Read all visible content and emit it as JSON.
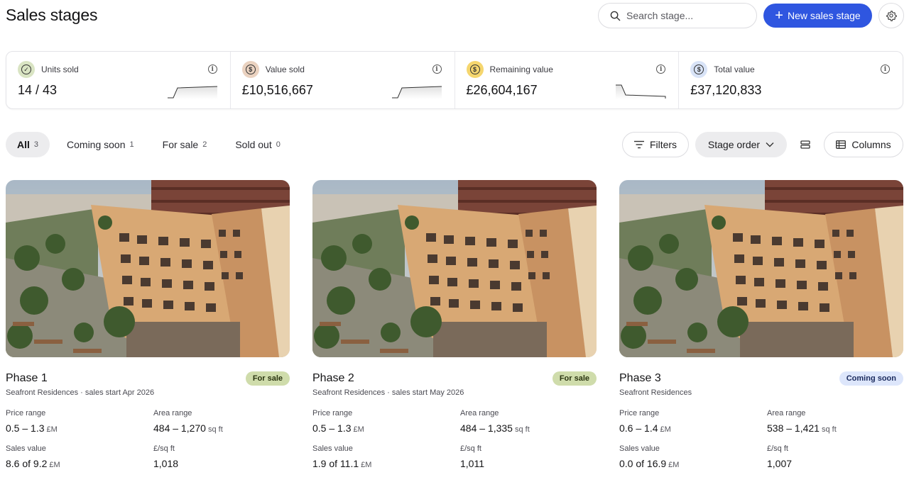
{
  "header": {
    "title": "Sales stages",
    "search_placeholder": "Search stage...",
    "new_button": "New sales stage"
  },
  "stats": [
    {
      "label": "Units sold",
      "value": "14 / 43",
      "icon": "check-circle-icon",
      "icon_bg": "#d9e4c3"
    },
    {
      "label": "Value sold",
      "value": "£10,516,667",
      "icon": "dollar-circle-icon",
      "icon_bg": "#ead2c0"
    },
    {
      "label": "Remaining value",
      "value": "£26,604,167",
      "icon": "dollar-circle-icon",
      "icon_bg": "#f5d66e"
    },
    {
      "label": "Total value",
      "value": "£37,120,833",
      "icon": "dollar-circle-icon",
      "icon_bg": "#d8e3f7"
    }
  ],
  "tabs": [
    {
      "label": "All",
      "count": "3",
      "active": true
    },
    {
      "label": "Coming soon",
      "count": "1",
      "active": false
    },
    {
      "label": "For sale",
      "count": "2",
      "active": false
    },
    {
      "label": "Sold out",
      "count": "0",
      "active": false
    }
  ],
  "toolbar": {
    "filters": "Filters",
    "order": "Stage order",
    "columns": "Columns"
  },
  "field_labels": {
    "price": "Price range",
    "area": "Area range",
    "sales": "Sales value",
    "psf": "£/sq ft"
  },
  "cards": [
    {
      "title": "Phase 1",
      "status": "For sale",
      "status_kind": "sale",
      "subtitle": "Seafront Residences · sales start Apr 2026",
      "price": "0.5 – 1.3",
      "price_unit": "£M",
      "area": "484 – 1,270",
      "area_unit": "sq ft",
      "sales": "8.6 of 9.2",
      "sales_unit": "£M",
      "psf": "1,018"
    },
    {
      "title": "Phase 2",
      "status": "For sale",
      "status_kind": "sale",
      "subtitle": "Seafront Residences · sales start May 2026",
      "price": "0.5 – 1.3",
      "price_unit": "£M",
      "area": "484 – 1,335",
      "area_unit": "sq ft",
      "sales": "1.9 of 11.1",
      "sales_unit": "£M",
      "psf": "1,011"
    },
    {
      "title": "Phase 3",
      "status": "Coming soon",
      "status_kind": "soon",
      "subtitle": "Seafront Residences",
      "price": "0.6 – 1.4",
      "price_unit": "£M",
      "area": "538 – 1,421",
      "area_unit": "sq ft",
      "sales": "0.0 of 16.9",
      "sales_unit": "£M",
      "psf": "1,007"
    }
  ],
  "colors": {
    "accent": "#2f56e0"
  }
}
